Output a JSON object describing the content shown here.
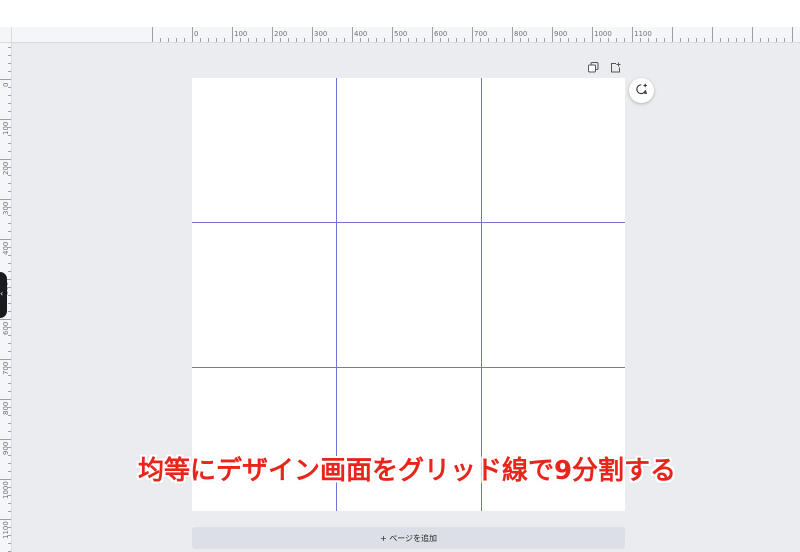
{
  "ruler": {
    "top_labels": [
      "0",
      "100",
      "200",
      "300",
      "400",
      "500",
      "600",
      "700",
      "800",
      "900",
      "1000",
      "1100"
    ],
    "left_labels": [
      "0",
      "100",
      "200",
      "300",
      "400",
      "500",
      "600",
      "700",
      "800",
      "900",
      "1000",
      "1100"
    ]
  },
  "page_actions": [
    {
      "name": "duplicate-page",
      "icon": "duplicate-icon"
    },
    {
      "name": "add-page",
      "icon": "add-page-icon"
    }
  ],
  "grid": {
    "rows": 3,
    "columns": 3,
    "line_color": "#6e74d6"
  },
  "comment_button": {
    "icon": "comment-add-icon"
  },
  "add_page_button": {
    "label": "+ ページを追加"
  },
  "caption": {
    "text": "均等にデザイン画面をグリッド線で9分割する",
    "color": "#e8251b"
  }
}
